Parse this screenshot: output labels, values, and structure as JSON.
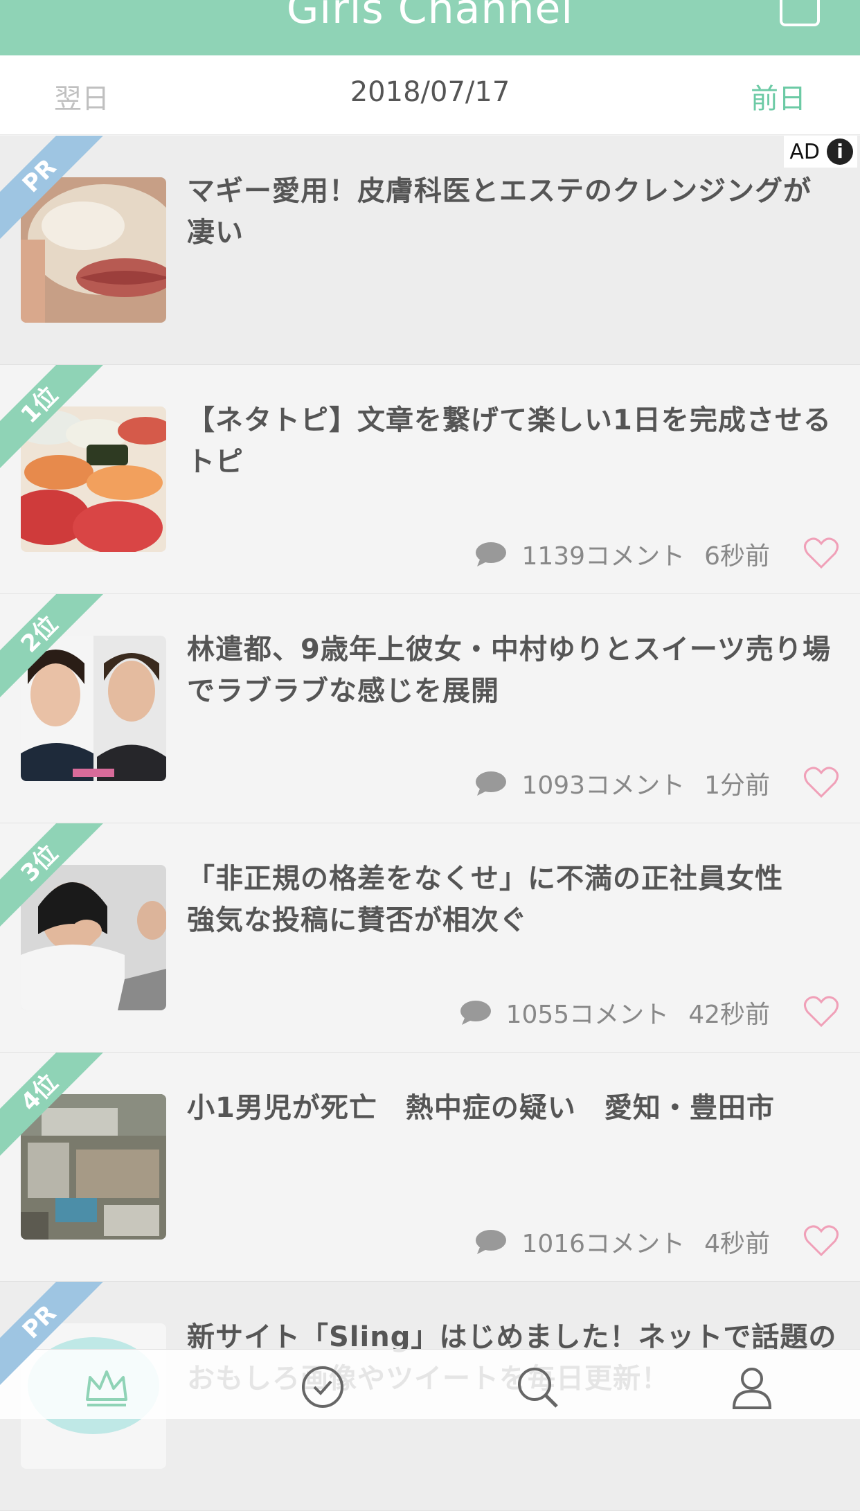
{
  "header": {
    "app_title": "Girls Channel"
  },
  "datebar": {
    "next_label": "翌日",
    "date": "2018/07/17",
    "prev_label": "前日"
  },
  "rows": [
    {
      "badge": "PR",
      "title": "マギー愛用！皮膚科医とエステのクレンジングが凄い",
      "ad_label": "AD"
    },
    {
      "badge": "1位",
      "title": "【ネタトピ】文章を繋げて楽しい1日を完成させるトピ",
      "comments": "1139コメント",
      "time": "6秒前"
    },
    {
      "badge": "2位",
      "title": "林遣都、9歳年上彼女・中村ゆりとスイーツ売り場でラブラブな感じを展開",
      "comments": "1093コメント",
      "time": "1分前"
    },
    {
      "badge": "3位",
      "title": "「非正規の格差をなくせ」に不満の正社員女性　強気な投稿に賛否が相次ぐ",
      "comments": "1055コメント",
      "time": "42秒前"
    },
    {
      "badge": "4位",
      "title": "小1男児が死亡　熱中症の疑い　愛知・豊田市",
      "comments": "1016コメント",
      "time": "4秒前"
    },
    {
      "badge": "PR",
      "title": "新サイト「Sling」はじめました！ネットで話題のおもしろ画像やツイートを毎日更新！"
    }
  ],
  "colors": {
    "accent": "#8fd3b6",
    "pr_blue": "#9ec5e2",
    "heart": "#f0a0b8"
  },
  "tabbar": {
    "icons": [
      "crown-icon",
      "clock-icon",
      "search-icon",
      "user-icon"
    ]
  }
}
